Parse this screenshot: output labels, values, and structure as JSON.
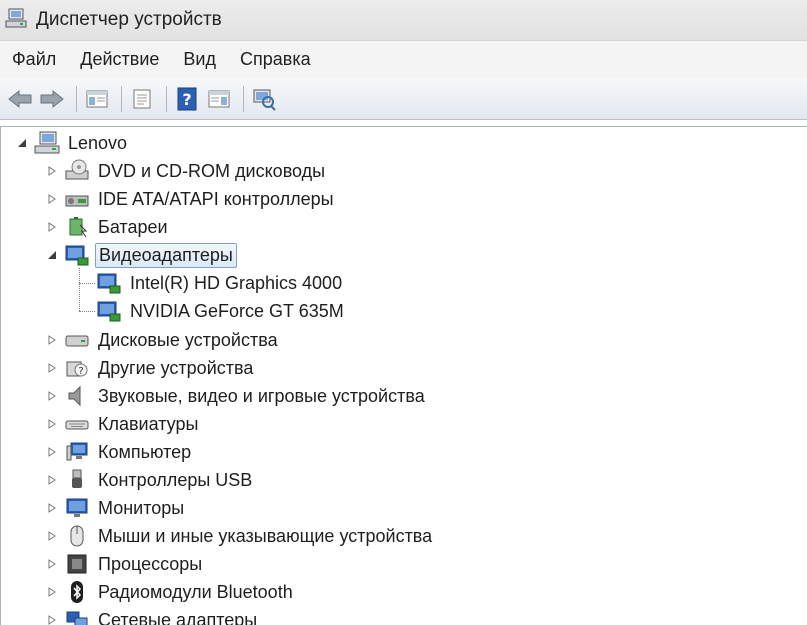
{
  "window": {
    "title": "Диспетчер устройств"
  },
  "menu": [
    {
      "label": "Файл"
    },
    {
      "label": "Действие"
    },
    {
      "label": "Вид"
    },
    {
      "label": "Справка"
    }
  ],
  "tree": {
    "root": "Lenovo",
    "categories": [
      {
        "label": "DVD и CD-ROM дисководы",
        "icon": "dvd-drive-icon"
      },
      {
        "label": "IDE ATA/ATAPI контроллеры",
        "icon": "ide-controller-icon"
      },
      {
        "label": "Батареи",
        "icon": "battery-icon"
      },
      {
        "label": "Видеоадаптеры",
        "icon": "display-adapter-icon",
        "expanded": true,
        "selected": true,
        "children": [
          {
            "label": "Intel(R) HD Graphics 4000"
          },
          {
            "label": "NVIDIA GeForce GT 635M"
          }
        ]
      },
      {
        "label": "Дисковые устройства",
        "icon": "disk-drive-icon"
      },
      {
        "label": "Другие устройства",
        "icon": "unknown-device-icon"
      },
      {
        "label": "Звуковые, видео и игровые устройства",
        "icon": "speaker-icon"
      },
      {
        "label": "Клавиатуры",
        "icon": "keyboard-icon"
      },
      {
        "label": "Компьютер",
        "icon": "computer-icon"
      },
      {
        "label": "Контроллеры USB",
        "icon": "usb-icon"
      },
      {
        "label": "Мониторы",
        "icon": "monitor-icon"
      },
      {
        "label": "Мыши и иные указывающие устройства",
        "icon": "mouse-icon"
      },
      {
        "label": "Процессоры",
        "icon": "processor-icon"
      },
      {
        "label": "Радиомодули Bluetooth",
        "icon": "bluetooth-icon"
      },
      {
        "label": "Сетевые адаптеры",
        "icon": "network-adapter-icon"
      }
    ]
  }
}
